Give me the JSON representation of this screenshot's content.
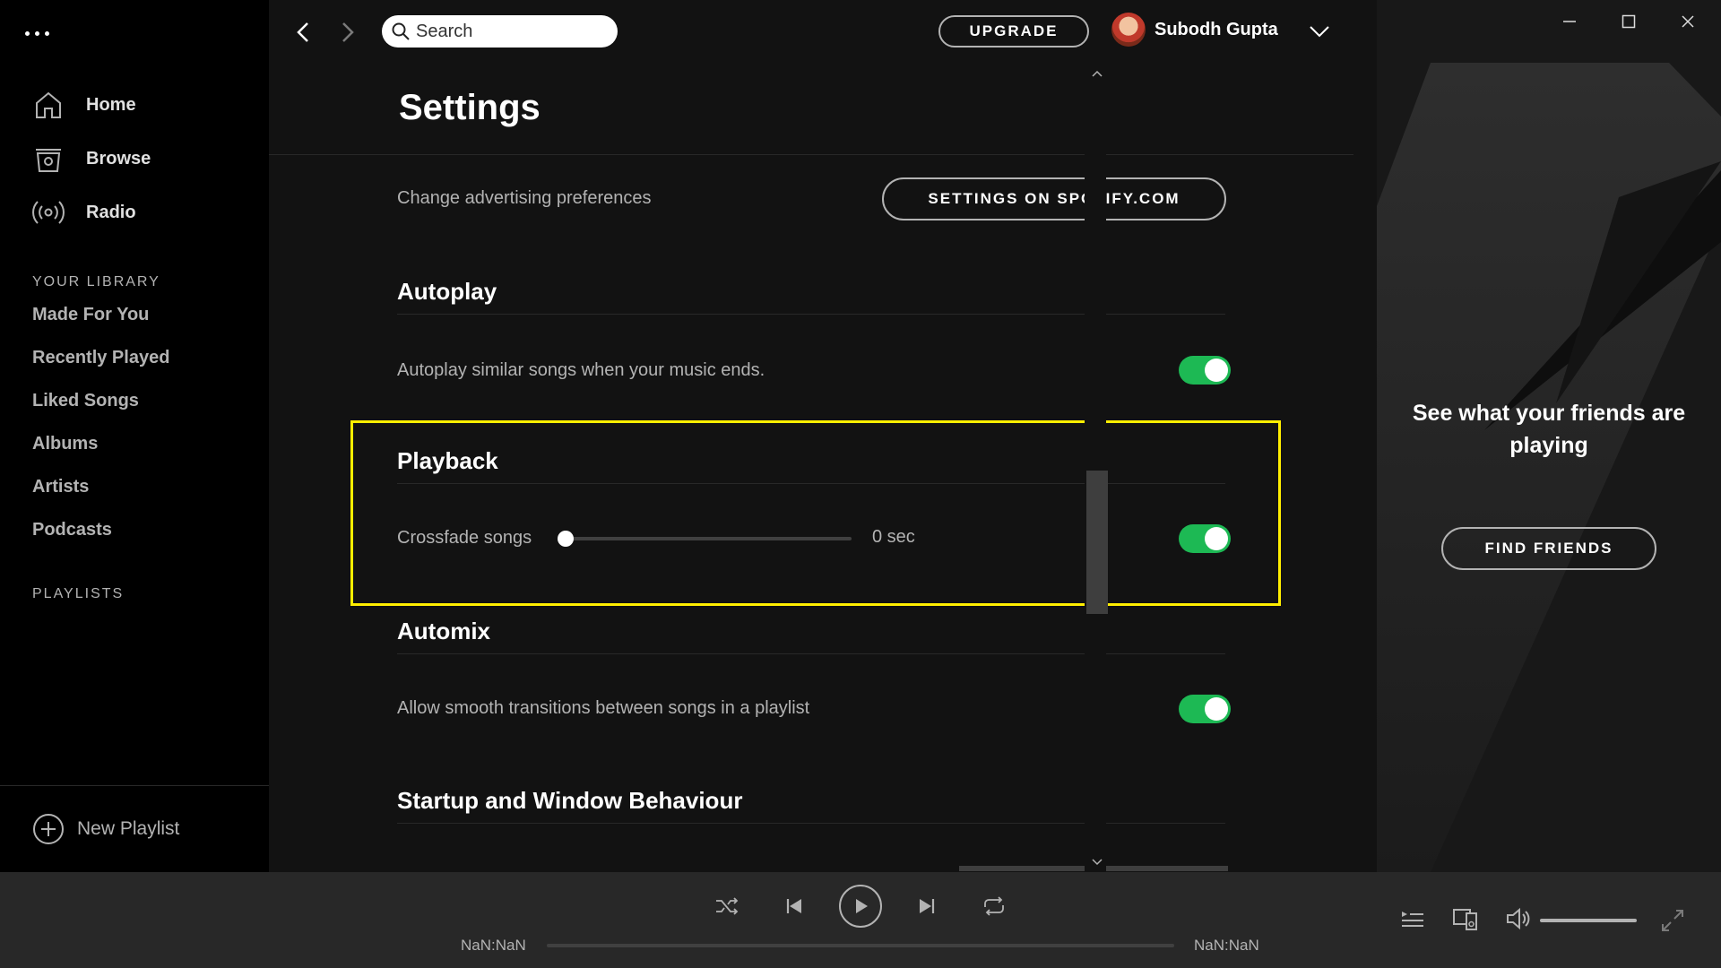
{
  "sidebar": {
    "nav": [
      {
        "label": "Home",
        "icon": "home-icon"
      },
      {
        "label": "Browse",
        "icon": "browse-icon"
      },
      {
        "label": "Radio",
        "icon": "radio-icon"
      }
    ],
    "library_label": "YOUR LIBRARY",
    "library": [
      "Made For You",
      "Recently Played",
      "Liked Songs",
      "Albums",
      "Artists",
      "Podcasts"
    ],
    "playlists_label": "PLAYLISTS",
    "new_playlist": "New Playlist"
  },
  "topbar": {
    "search_placeholder": "Search",
    "upgrade": "UPGRADE",
    "user_name": "Subodh Gupta"
  },
  "page": {
    "title": "Settings",
    "ads_row": {
      "text": "Change advertising preferences",
      "button": "SETTINGS ON SPOTIFY.COM"
    },
    "sections": [
      {
        "title": "Autoplay",
        "row": "Autoplay similar songs when your music ends.",
        "enabled": true
      },
      {
        "title": "Playback",
        "row": "Crossfade songs",
        "slider_value": "0 sec",
        "slider_fraction": 0,
        "enabled": true
      },
      {
        "title": "Automix",
        "row": "Allow smooth transitions between songs in a playlist",
        "enabled": true
      },
      {
        "title": "Startup and Window Behaviour"
      }
    ]
  },
  "friends": {
    "title": "See what your friends are playing",
    "button": "FIND FRIENDS"
  },
  "player": {
    "elapsed": "NaN:NaN",
    "duration": "NaN:NaN"
  },
  "colors": {
    "accent": "#1db954",
    "highlight": "#ffee00",
    "background": "#121212"
  }
}
